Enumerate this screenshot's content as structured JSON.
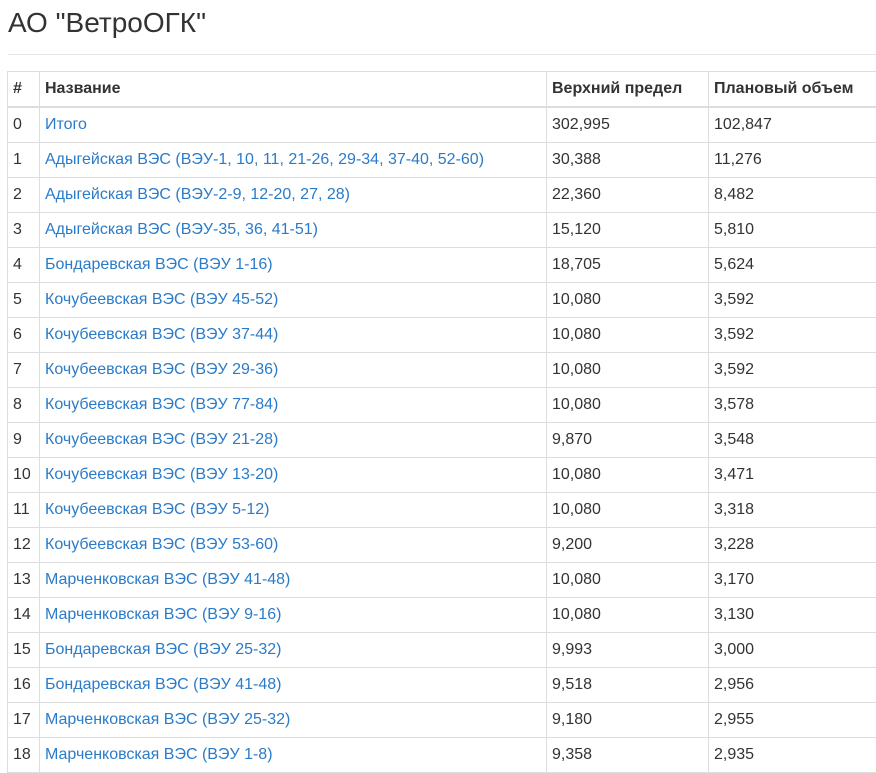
{
  "page": {
    "title": "АО \"ВетроОГК\""
  },
  "colors": {
    "link": "#2a7bc9",
    "text": "#333333",
    "border": "#dddddd"
  },
  "table": {
    "headers": {
      "index": "#",
      "name": "Название",
      "upper_limit": "Верхний предел",
      "planned_volume": "Плановый объем"
    },
    "rows": [
      {
        "index": "0",
        "name": "Итого",
        "upper_limit": "302,995",
        "planned_volume": "102,847"
      },
      {
        "index": "1",
        "name": "Адыгейская ВЭС (ВЭУ-1, 10, 11, 21-26, 29-34, 37-40, 52-60)",
        "upper_limit": "30,388",
        "planned_volume": "11,276"
      },
      {
        "index": "2",
        "name": "Адыгейская ВЭС (ВЭУ-2-9, 12-20, 27, 28)",
        "upper_limit": "22,360",
        "planned_volume": "8,482"
      },
      {
        "index": "3",
        "name": "Адыгейская ВЭС (ВЭУ-35, 36, 41-51)",
        "upper_limit": "15,120",
        "planned_volume": "5,810"
      },
      {
        "index": "4",
        "name": "Бондаревская ВЭС (ВЭУ 1-16)",
        "upper_limit": "18,705",
        "planned_volume": "5,624"
      },
      {
        "index": "5",
        "name": "Кочубеевская ВЭС (ВЭУ 45-52)",
        "upper_limit": "10,080",
        "planned_volume": "3,592"
      },
      {
        "index": "6",
        "name": "Кочубеевская ВЭС (ВЭУ 37-44)",
        "upper_limit": "10,080",
        "planned_volume": "3,592"
      },
      {
        "index": "7",
        "name": "Кочубеевская ВЭС (ВЭУ 29-36)",
        "upper_limit": "10,080",
        "planned_volume": "3,592"
      },
      {
        "index": "8",
        "name": "Кочубеевская ВЭС (ВЭУ 77-84)",
        "upper_limit": "10,080",
        "planned_volume": "3,578"
      },
      {
        "index": "9",
        "name": "Кочубеевская ВЭС (ВЭУ 21-28)",
        "upper_limit": "9,870",
        "planned_volume": "3,548"
      },
      {
        "index": "10",
        "name": "Кочубеевская ВЭС (ВЭУ 13-20)",
        "upper_limit": "10,080",
        "planned_volume": "3,471"
      },
      {
        "index": "11",
        "name": "Кочубеевская ВЭС (ВЭУ 5-12)",
        "upper_limit": "10,080",
        "planned_volume": "3,318"
      },
      {
        "index": "12",
        "name": "Кочубеевская ВЭС (ВЭУ 53-60)",
        "upper_limit": "9,200",
        "planned_volume": "3,228"
      },
      {
        "index": "13",
        "name": "Марченковская ВЭС (ВЭУ 41-48)",
        "upper_limit": "10,080",
        "planned_volume": "3,170"
      },
      {
        "index": "14",
        "name": "Марченковская ВЭС (ВЭУ 9-16)",
        "upper_limit": "10,080",
        "planned_volume": "3,130"
      },
      {
        "index": "15",
        "name": "Бондаревская ВЭС (ВЭУ 25-32)",
        "upper_limit": "9,993",
        "planned_volume": "3,000"
      },
      {
        "index": "16",
        "name": "Бондаревская ВЭС (ВЭУ 41-48)",
        "upper_limit": "9,518",
        "planned_volume": "2,956"
      },
      {
        "index": "17",
        "name": "Марченковская ВЭС (ВЭУ 25-32)",
        "upper_limit": "9,180",
        "planned_volume": "2,955"
      },
      {
        "index": "18",
        "name": "Марченковская ВЭС (ВЭУ 1-8)",
        "upper_limit": "9,358",
        "planned_volume": "2,935"
      }
    ]
  }
}
